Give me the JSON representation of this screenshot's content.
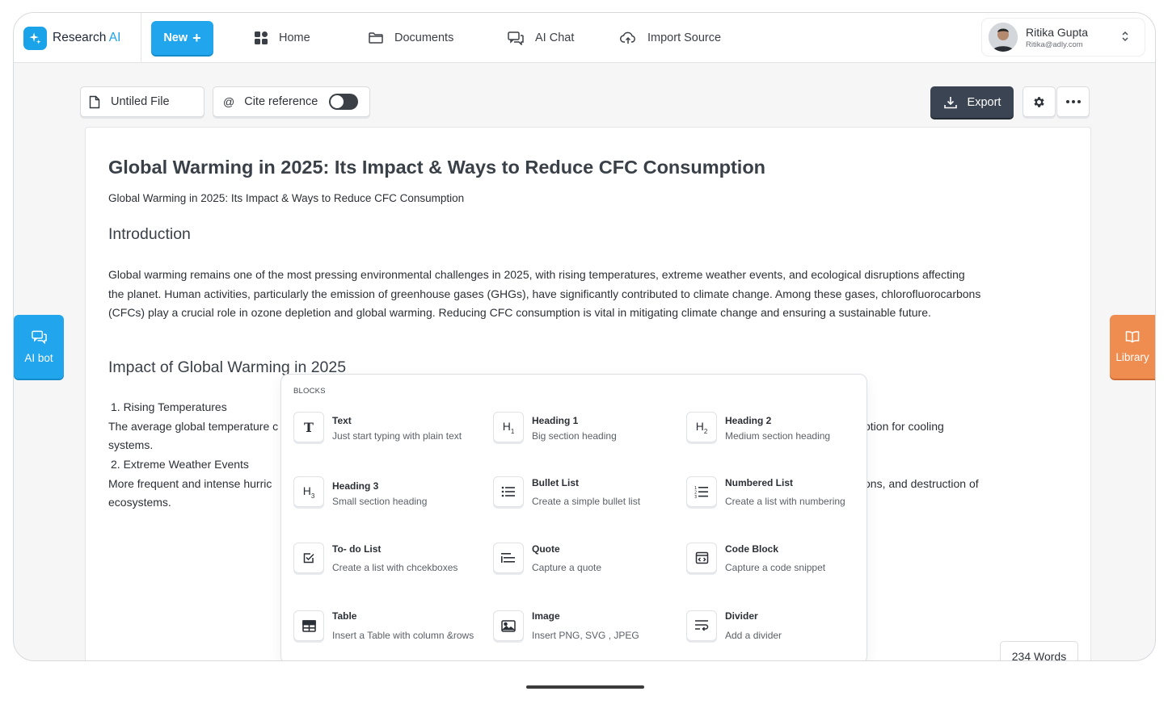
{
  "brand": {
    "name": "Research ",
    "accent": "AI",
    "accent_color": "#1aa3e8"
  },
  "topbar": {
    "new_label": "New",
    "nav": [
      {
        "label": "Home",
        "icon": "grid-icon"
      },
      {
        "label": "Documents",
        "icon": "folder-icon"
      },
      {
        "label": "AI Chat",
        "icon": "chat-icon"
      },
      {
        "label": "Import Source",
        "icon": "cloud-upload-icon"
      }
    ],
    "user": {
      "name": "Ritika Gupta",
      "email": "Ritika@adly.com"
    }
  },
  "toolbar": {
    "file_name": "Untiled File",
    "cite_label": "Cite reference",
    "cite_enabled": false,
    "export_label": "Export"
  },
  "document": {
    "title": "Global Warming in 2025: Its Impact & Ways to Reduce CFC Consumption",
    "subtitle": "Global Warming in 2025: Its Impact & Ways to Reduce CFC Consumption",
    "intro_heading": "Introduction",
    "intro_text": "Global warming remains one of the most pressing environmental challenges in 2025, with rising temperatures, extreme weather events, and ecological disruptions affecting the planet. Human activities, particularly the emission of greenhouse gases (GHGs), have significantly contributed to climate change. Among these gases, chlorofluorocarbons (CFCs) play a crucial role in ozone depletion and global warming. Reducing CFC consumption is vital in mitigating climate change and ensuring a sustainable future.",
    "impact_heading": "Impact of Global Warming in 2025",
    "item1_title": "1. Rising Temperatures",
    "item1_text_start": "The average global temperature c",
    "item1_text_end": "ption for cooling",
    "item1_text_wrap": "systems.",
    "item2_title": "2. Extreme Weather Events",
    "item2_text_start": "More frequent and intense hurric",
    "item2_text_end": "ons, and destruction of",
    "item2_text_wrap": "ecosystems.",
    "word_count": "234 Words"
  },
  "side_tabs": {
    "left": "AI bot",
    "right": "Library"
  },
  "blocks_menu": {
    "label": "BLOCKS",
    "items": [
      {
        "title": "Text",
        "desc": "Just start typing with plain text",
        "icon": "text-icon"
      },
      {
        "title": "Heading 1",
        "desc": "Big section heading",
        "icon": "heading1-icon"
      },
      {
        "title": "Heading 2",
        "desc": "Medium section heading",
        "icon": "heading2-icon"
      },
      {
        "title": "Heading 3",
        "desc": "Small section heading",
        "icon": "heading3-icon"
      },
      {
        "title": "Bullet List",
        "desc": "Create a simple bullet list",
        "icon": "bullet-list-icon"
      },
      {
        "title": "Numbered List",
        "desc": "Create a list with numbering",
        "icon": "numbered-list-icon"
      },
      {
        "title": "To- do List",
        "desc": "Create a list with chcekboxes",
        "icon": "checkbox-icon"
      },
      {
        "title": "Quote",
        "desc": "Capture a quote",
        "icon": "quote-icon"
      },
      {
        "title": "Code Block",
        "desc": "Capture a code snippet",
        "icon": "code-icon"
      },
      {
        "title": "Table",
        "desc": "Insert a Table with column &rows",
        "icon": "table-icon"
      },
      {
        "title": "Image",
        "desc": "Insert PNG, SVG , JPEG",
        "icon": "image-icon"
      },
      {
        "title": "Divider",
        "desc": "Add a divider",
        "icon": "divider-icon"
      }
    ]
  },
  "colors": {
    "primary": "#21a6ee",
    "export_bg": "#3a4452",
    "library": "#ef8c4f"
  }
}
